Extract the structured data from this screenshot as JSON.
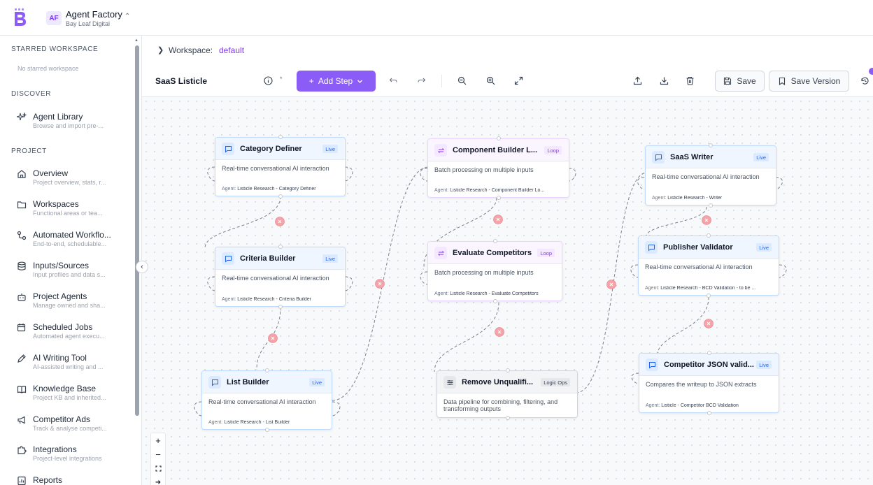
{
  "app": {
    "badge": "AF",
    "name": "Agent Factory",
    "org": "Bay Leaf Digital"
  },
  "sidebar": {
    "starred_heading": "STARRED WORKSPACE",
    "starred_empty": "No starred workspace",
    "discover_heading": "DISCOVER",
    "discover_items": [
      {
        "label": "Agent Library",
        "desc": "Browse and import pre-...",
        "icon": "sparkle-icon"
      }
    ],
    "project_heading": "PROJECT",
    "project_items": [
      {
        "label": "Overview",
        "desc": "Project overview, stats, r...",
        "icon": "home-icon"
      },
      {
        "label": "Workspaces",
        "desc": "Functional areas or tea...",
        "icon": "folder-icon"
      },
      {
        "label": "Automated Workflo...",
        "desc": "End-to-end, schedulable...",
        "icon": "workflow-icon"
      },
      {
        "label": "Inputs/Sources",
        "desc": "Input profiles and data s...",
        "icon": "database-icon"
      },
      {
        "label": "Project Agents",
        "desc": "Manage owned and sha...",
        "icon": "bot-icon"
      },
      {
        "label": "Scheduled Jobs",
        "desc": "Automated agent execu...",
        "icon": "calendar-clock-icon"
      },
      {
        "label": "AI Writing Tool",
        "desc": "AI-assisted writing and ...",
        "icon": "pen-icon"
      },
      {
        "label": "Knowledge Base",
        "desc": "Project KB and inherited...",
        "icon": "book-icon"
      },
      {
        "label": "Competitor Ads",
        "desc": "Track & analyse competi...",
        "icon": "megaphone-icon"
      },
      {
        "label": "Integrations",
        "desc": "Project-level integrations",
        "icon": "puzzle-icon"
      },
      {
        "label": "Reports",
        "desc": "",
        "icon": "report-icon"
      }
    ]
  },
  "breadcrumb": {
    "label": "Workspace:",
    "value": "default"
  },
  "toolbar": {
    "workflow_name": "SaaS Listicle",
    "add_step": "Add Step",
    "save": "Save",
    "save_version": "Save Version"
  },
  "nodes": [
    {
      "id": "category-definer",
      "title": "Category Definer",
      "badge": "Live",
      "kind": "live",
      "desc": "Real-time conversational AI interaction",
      "agent_label": "Agent:",
      "agent": "Listicle Research - Category Definer"
    },
    {
      "id": "criteria-builder",
      "title": "Criteria Builder",
      "badge": "Live",
      "kind": "live",
      "desc": "Real-time conversational AI interaction",
      "agent_label": "Agent:",
      "agent": "Listicle Research - Criteria Builder"
    },
    {
      "id": "list-builder",
      "title": "List Builder",
      "badge": "Live",
      "kind": "live",
      "desc": "Real-time conversational AI interaction",
      "agent_label": "Agent:",
      "agent": "Listicle Research - List Builder"
    },
    {
      "id": "component-builder",
      "title": "Component Builder L...",
      "badge": "Loop",
      "kind": "loop",
      "desc": "Batch processing on multiple inputs",
      "agent_label": "Agent:",
      "agent": "Listicle Research - Component Builder Lo..."
    },
    {
      "id": "evaluate-competitors",
      "title": "Evaluate Competitors",
      "badge": "Loop",
      "kind": "loop",
      "desc": "Batch processing on multiple inputs",
      "agent_label": "Agent:",
      "agent": "Listicle Research - Evaluate Competitors"
    },
    {
      "id": "remove-unqualified",
      "title": "Remove Unqualifi...",
      "badge": "Logic Ops",
      "kind": "logic",
      "desc": "Data pipeline for combining, filtering, and transforming outputs",
      "agent_label": "",
      "agent": ""
    },
    {
      "id": "saas-writer",
      "title": "SaaS Writer",
      "badge": "Live",
      "kind": "live",
      "desc": "Real-time conversational AI interaction",
      "agent_label": "Agent:",
      "agent": "Listicle Research - Writer"
    },
    {
      "id": "publisher-validator",
      "title": "Publisher Validator",
      "badge": "Live",
      "kind": "live",
      "desc": "Real-time conversational AI interaction",
      "agent_label": "Agent:",
      "agent": "Listicle Research - BCD Validation - to be ..."
    },
    {
      "id": "competitor-json",
      "title": "Competitor JSON valid...",
      "badge": "Live",
      "kind": "live",
      "desc": "Compares the writeup to JSON extracts",
      "agent_label": "Agent:",
      "agent": "Listicle - Competitor BCD Validation"
    }
  ],
  "colors": {
    "accent": "#8b5cf6",
    "edge": "#6b7280",
    "delete_dot": "#f3a3a8"
  }
}
